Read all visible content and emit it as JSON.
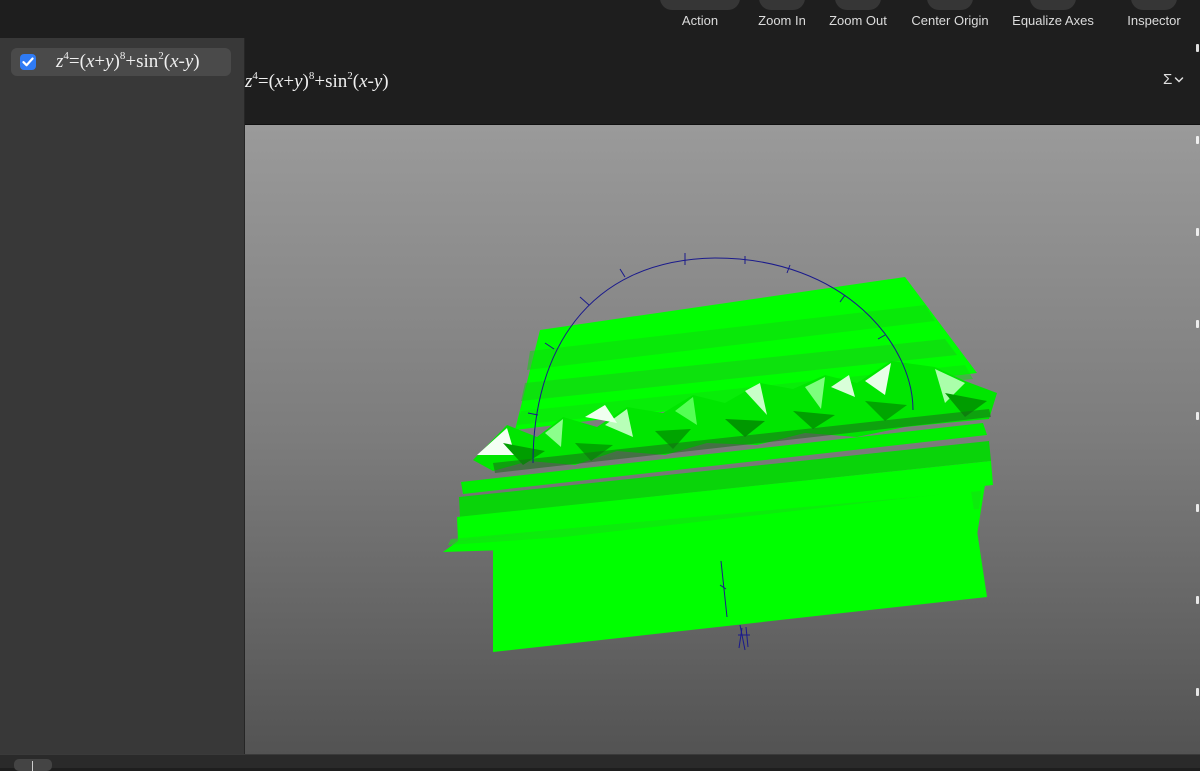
{
  "toolbar": {
    "items": [
      {
        "label": "Action"
      },
      {
        "label": "Zoom In"
      },
      {
        "label": "Zoom Out"
      },
      {
        "label": "Center Origin"
      },
      {
        "label": "Equalize Axes"
      },
      {
        "label": "Inspector"
      }
    ]
  },
  "sidebar": {
    "equation": {
      "checked": true,
      "z": "z",
      "z_exp": "4",
      "expr_a": "=(",
      "x": "x",
      "plus": "+",
      "y": "y",
      "close_paren": ")",
      "exp8": "8",
      "plus_sin": "+sin",
      "sin_exp": "2",
      "paren_open": "(",
      "minus": "-",
      "end": ")"
    }
  },
  "header": {
    "equation": {
      "z": "z",
      "z_exp": "4",
      "expr_a": "=(",
      "x": "x",
      "plus": "+",
      "y": "y",
      "close_paren": ")",
      "exp8": "8",
      "plus_sin": "+sin",
      "sin_exp": "2",
      "paren_open": "(",
      "minus": "-",
      "end": ")"
    },
    "sigma_label": "Σ"
  },
  "colors": {
    "surface": "#00ff00",
    "axes": "#1a1a8c",
    "checkbox": "#2f7bf5"
  }
}
